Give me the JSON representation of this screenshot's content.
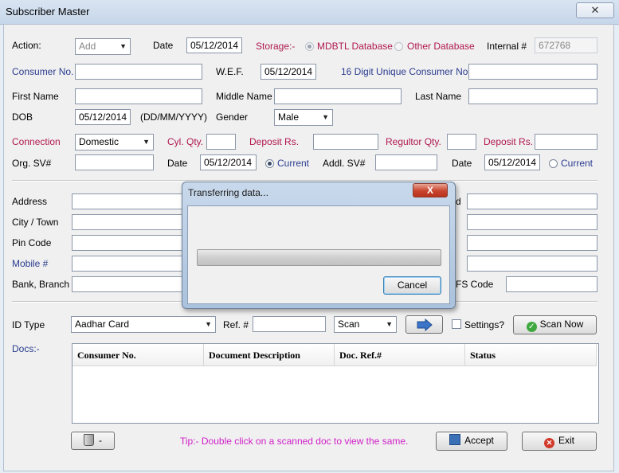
{
  "window": {
    "title": "Subscriber Master",
    "close_symbol": "✕"
  },
  "row_action": {
    "action_label": "Action:",
    "action_value": "Add",
    "date_label": "Date",
    "date_value": "05/12/2014",
    "storage_label": "Storage:-",
    "mdbtl_label": "MDBTL Database",
    "other_label": "Other Database",
    "internal_label": "Internal #",
    "internal_value": "672768"
  },
  "row_consumer": {
    "consumer_label": "Consumer No.",
    "consumer_value": "",
    "wef_label": "W.E.F.",
    "wef_value": "05/12/2014",
    "unique_label": "16 Digit Unique Consumer No.",
    "unique_value": ""
  },
  "row_name": {
    "first_label": "First Name",
    "middle_label": "Middle Name",
    "last_label": "Last Name"
  },
  "row_dob": {
    "dob_label": "DOB",
    "dob_value": "05/12/2014",
    "dob_format": "(DD/MM/YYYY)",
    "gender_label": "Gender",
    "gender_value": "Male"
  },
  "row_connection": {
    "connection_label": "Connection",
    "connection_value": "Domestic",
    "cyl_label": "Cyl. Qty.",
    "deposit_label": "Deposit Rs.",
    "regulator_label": "Regultor Qty.",
    "deposit2_label": "Deposit Rs."
  },
  "row_sv": {
    "orgsv_label": "Org. SV#",
    "date_label": "Date",
    "date_value": "05/12/2014",
    "current_label": "Current",
    "addlsv_label": "Addl. SV#",
    "date2_label": "Date",
    "date2_value": "05/12/2014",
    "current2_label": "Current"
  },
  "address": {
    "address_label": "Address",
    "city_label": "City / Town",
    "pin_label": "Pin Code",
    "mobile_label": "Mobile #",
    "bank_label": "Bank, Branch",
    "right_partial_label": "d",
    "ifsc_partial_label": "FS Code"
  },
  "id_row": {
    "idtype_label": "ID Type",
    "idtype_value": "Aadhar Card",
    "ref_label": "Ref. #",
    "scan_value": "Scan",
    "settings_label": "Settings?",
    "scan_now_label": "Scan Now"
  },
  "docs": {
    "label": "Docs:-",
    "columns": [
      "Consumer No.",
      "Document Description",
      "Doc. Ref.#",
      "Status"
    ]
  },
  "footer": {
    "minus_label": "-",
    "tip": "Tip:- Double click on a scanned doc to view the same.",
    "accept_label": "Accept",
    "exit_label": "Exit"
  },
  "dialog": {
    "title": "Transferring data...",
    "close_symbol": "X",
    "progress_fraction": 0,
    "cancel_label": "Cancel"
  }
}
